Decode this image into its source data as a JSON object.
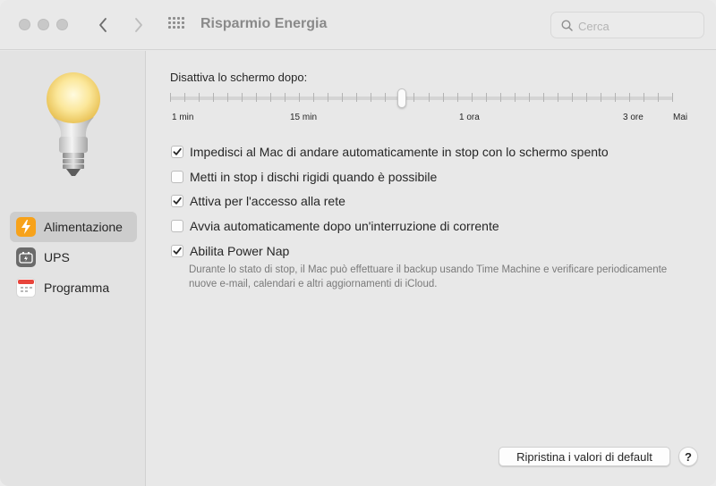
{
  "window": {
    "title": "Risparmio Energia"
  },
  "search": {
    "placeholder": "Cerca",
    "value": ""
  },
  "sidebar": {
    "items": [
      {
        "label": "Alimentazione",
        "icon": "lightning-icon",
        "selected": true,
        "icon_color": "#f7a21a"
      },
      {
        "label": "UPS",
        "icon": "ups-icon",
        "selected": false,
        "icon_color": "#6b6b6b"
      },
      {
        "label": "Programma",
        "icon": "calendar-icon",
        "selected": false,
        "icon_color": "#ffffff"
      }
    ]
  },
  "display_sleep": {
    "label": "Disattiva lo schermo dopo:",
    "tick_labels": [
      "1 min",
      "15 min",
      "1 ora",
      "3 ore",
      "Mai"
    ],
    "position_fraction": 0.46
  },
  "options": [
    {
      "label": "Impedisci al Mac di andare automaticamente in stop con lo schermo spento",
      "checked": true
    },
    {
      "label": "Metti in stop i dischi rigidi quando è possibile",
      "checked": false
    },
    {
      "label": "Attiva per l'accesso alla rete",
      "checked": true
    },
    {
      "label": "Avvia automaticamente dopo un'interruzione di corrente",
      "checked": false
    },
    {
      "label": "Abilita Power Nap",
      "checked": true
    }
  ],
  "power_nap_description": "Durante lo stato di stop, il Mac può effettuare il backup usando Time Machine e verificare periodicamente nuove e-mail, calendari e altri aggiornamenti di iCloud.",
  "buttons": {
    "reset": "Ripristina i valori di default",
    "help": "?"
  },
  "colors": {
    "accent_orange": "#f7a21a",
    "calendar_red": "#e8453c",
    "text": "#262626",
    "secondary_text": "#7a7a7a"
  }
}
